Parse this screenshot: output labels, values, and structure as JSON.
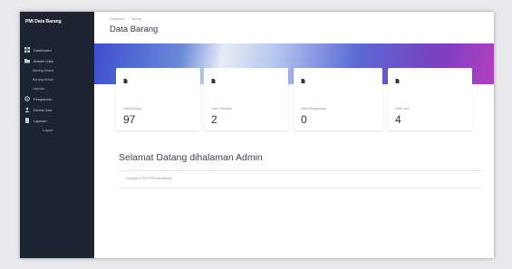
{
  "sidebar": {
    "brand": "PMI Data Barang",
    "items": [
      {
        "label": "Dashboard",
        "icon": "dashboard-icon"
      },
      {
        "label": "Master Data",
        "icon": "folder-icon"
      },
      {
        "label": "Barang Masuk",
        "icon": "inbox-icon"
      },
      {
        "label": "Barang Keluar",
        "icon": "box-icon"
      },
      {
        "label": "Laporan",
        "icon": "file-icon"
      },
      {
        "label": "Pengaturan",
        "icon": "settings-icon"
      },
      {
        "label": "Kelola User",
        "icon": "users-icon"
      },
      {
        "label": "Logout",
        "icon": "logout-icon"
      }
    ]
  },
  "header": {
    "breadcrumb": [
      "Dashboard",
      "/",
      "Barang"
    ],
    "title": "Data Barang"
  },
  "cards": [
    {
      "label": "Data Barang",
      "value": "97",
      "color": "#2f3540"
    },
    {
      "label": "Data Pemasok",
      "value": "2",
      "color": "#2f3540"
    },
    {
      "label": "Data Pengeluaran",
      "value": "0",
      "color": "#2f3540"
    },
    {
      "label": "Data User",
      "value": "4",
      "color": "#2f3540"
    }
  ],
  "welcome": "Selamat Datang dihalaman Admin",
  "footer": {
    "copyright": "Copyright © 2024 PMI Data Barang"
  },
  "colors": {
    "sidebar_bg": "#1c2331",
    "banner_start": "#3d4ecf",
    "banner_end": "#b13fc0"
  }
}
